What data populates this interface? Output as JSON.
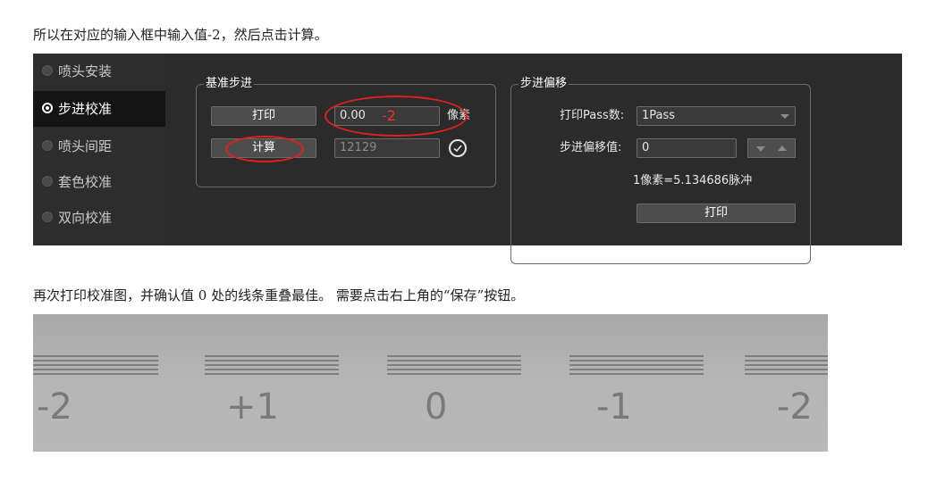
{
  "text": {
    "intro": "所以在对应的输入框中输入值-2，然后点击计算。",
    "after": "再次打印校准图，并确认值 0 处的线条重叠最佳。 需要点击右上角的“保存”按钮。"
  },
  "sidebar": {
    "items": [
      {
        "label": "喷头安装",
        "active": false
      },
      {
        "label": "步进校准",
        "active": true
      },
      {
        "label": "喷头间距",
        "active": false
      },
      {
        "label": "套色校准",
        "active": false
      },
      {
        "label": "双向校准",
        "active": false
      }
    ]
  },
  "base_step": {
    "title": "基准步进",
    "print_label": "打印",
    "pixel_value": "0.00",
    "annotation_value": "-2",
    "pixel_unit": "像素",
    "calc_label": "计算",
    "result_value": "12129",
    "confirm_icon": "check-circle-icon"
  },
  "step_offset": {
    "title": "步进偏移",
    "pass_label": "打印Pass数:",
    "pass_value": "1Pass",
    "offset_label": "步进偏移值:",
    "offset_value": "0",
    "conversion": "1像素=5.134686脉冲",
    "print_label": "打印"
  },
  "photo": {
    "labels": [
      "-2",
      "+1",
      "0",
      "-1",
      "-2"
    ]
  },
  "colors": {
    "annotation": "#e02020",
    "panel_bg": "#2b2b2b",
    "active_item_bg": "#141414"
  }
}
